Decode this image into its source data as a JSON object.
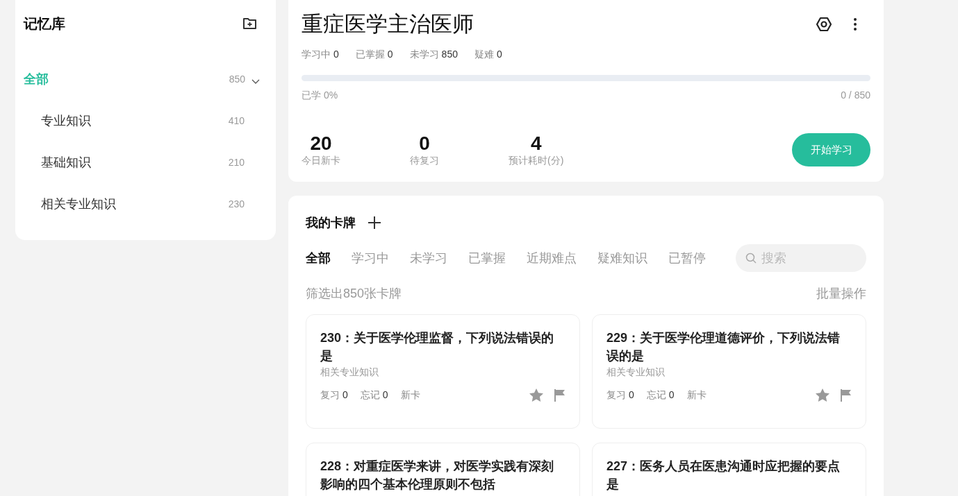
{
  "sidebar": {
    "title": "记忆库",
    "tree": [
      {
        "label": "全部",
        "count": "850",
        "selected": true,
        "expanded": true,
        "children": [
          {
            "label": "专业知识",
            "count": "410",
            "selected": false
          },
          {
            "label": "基础知识",
            "count": "210",
            "selected": false
          },
          {
            "label": "相关专业知识",
            "count": "230",
            "selected": false
          }
        ]
      }
    ]
  },
  "deck": {
    "title": "重症医学主治医师",
    "stats": [
      {
        "label": "学习中",
        "value": "0"
      },
      {
        "label": "已掌握",
        "value": "0"
      },
      {
        "label": "未学习",
        "value": "850"
      },
      {
        "label": "疑难",
        "value": "0"
      }
    ],
    "progress": {
      "level": 0,
      "label": "已学 0%",
      "count": "0 / 850"
    },
    "metrics": [
      {
        "value": "20",
        "label": "今日新卡"
      },
      {
        "value": "0",
        "label": "待复习"
      },
      {
        "value": "4",
        "label": "预计耗时(分)"
      }
    ],
    "start_button": "开始学习"
  },
  "cards_panel": {
    "title": "我的卡牌",
    "tabs": [
      {
        "label": "全部",
        "selected": true
      },
      {
        "label": "学习中",
        "selected": false
      },
      {
        "label": "未学习",
        "selected": false
      },
      {
        "label": "已掌握",
        "selected": false
      },
      {
        "label": "近期难点",
        "selected": false
      },
      {
        "label": "疑难知识",
        "selected": false
      },
      {
        "label": "已暂停",
        "selected": false
      }
    ],
    "search": {
      "placeholder": "搜索"
    },
    "filter_summary": "筛选出850张卡牌",
    "batch_action": "批量操作",
    "cards": [
      {
        "title": "230：关于医学伦理监督，下列说法错误的是",
        "category": "相关专业知识",
        "review": "复习",
        "review_count": "0",
        "forget": "忘记",
        "forget_count": "0",
        "status": "新卡"
      },
      {
        "title": "229：关于医学伦理道德评价，下列说法错误的是",
        "category": "相关专业知识",
        "review": "复习",
        "review_count": "0",
        "forget": "忘记",
        "forget_count": "0",
        "status": "新卡"
      },
      {
        "title": "228：对重症医学来讲，对医学实践有深刻影响的四个基本伦理原则不包括"
      },
      {
        "title": "227：医务人员在医患沟通时应把握的要点是"
      }
    ]
  }
}
